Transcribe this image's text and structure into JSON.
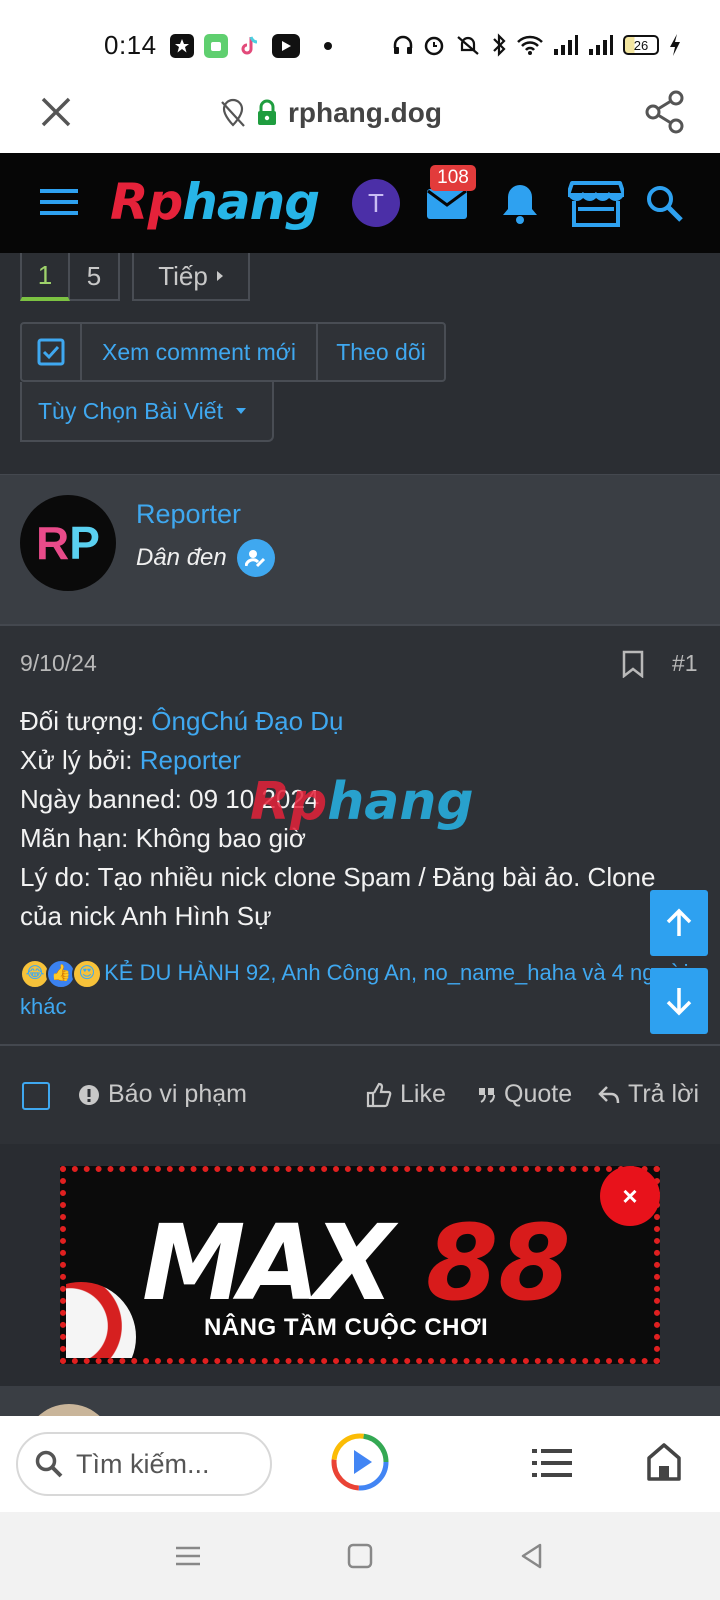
{
  "status_bar": {
    "time": "0:14",
    "battery": "26",
    "left_icons": [
      "star-app-icon",
      "android-app-icon",
      "tiktok-icon",
      "youtube-icon",
      "dot-icon"
    ],
    "right_icons": [
      "headset-icon",
      "alarm-icon",
      "mute-vibrate-icon",
      "bluetooth-icon",
      "wifi-icon",
      "signal-icon",
      "signal-icon",
      "battery-icon",
      "charging-icon"
    ]
  },
  "browser": {
    "domain": "rphang.dog",
    "search_placeholder": "Tìm kiếm..."
  },
  "site": {
    "logo_part1": "Rp",
    "logo_part2": "hang",
    "avatar_letter": "T",
    "mail_badge": "108"
  },
  "pagination": {
    "pages": [
      "1",
      "5"
    ],
    "next_label": "Tiếp"
  },
  "thread_actions": {
    "new_comments": "Xem comment mới",
    "follow": "Theo dõi",
    "options": "Tùy Chọn Bài Viết"
  },
  "post": {
    "avatar_text_r": "R",
    "avatar_text_p": "P",
    "username": "Reporter",
    "user_title": "Dân đen",
    "date": "9/10/24",
    "post_number": "#1",
    "lines": {
      "target_label": "Đối tượng: ",
      "target_value": "ÔngChú Đạo Dụ",
      "handled_label": "Xử lý bởi: ",
      "handled_value": "Reporter",
      "banned_date": "Ngày banned: 09 10 2024",
      "expiry": "Mãn hạn: Không bao giờ",
      "reason": "Lý do: Tạo nhiều nick clone Spam / Đăng bài ảo. Clone của nick Anh Hình Sự"
    },
    "watermark_part1": "Rp",
    "watermark_part2": "hang",
    "reactions_text": "KẺ DU HÀNH 92, Anh Công An, no_name_haha và 4 người khác",
    "report_label": "Báo vi phạm",
    "like_label": "Like",
    "quote_label": "Quote",
    "reply_label": "Trả lời"
  },
  "ad": {
    "brand": "MAX",
    "brand_number": "88",
    "tagline": "NÂNG TẦM CUỘC CHƠI",
    "close": "×"
  },
  "colors": {
    "accent": "#3fa8f0",
    "header_bg": "#060606",
    "page_bg": "#2b2e33",
    "logo_red": "#e5223a",
    "logo_blue": "#27b5e8",
    "active_page": "#7cc242"
  }
}
